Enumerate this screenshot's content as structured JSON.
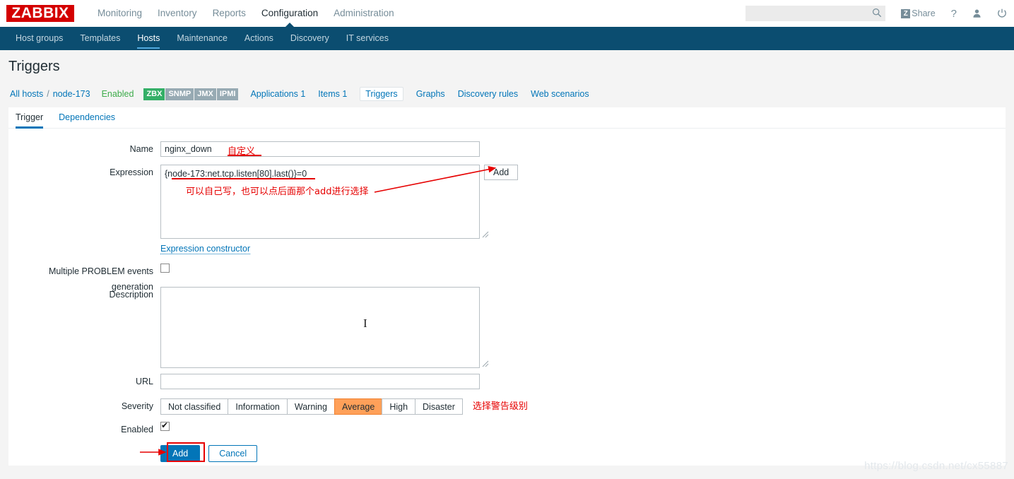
{
  "header": {
    "logo": "ZABBIX",
    "nav": [
      {
        "label": "Monitoring",
        "active": false
      },
      {
        "label": "Inventory",
        "active": false
      },
      {
        "label": "Reports",
        "active": false
      },
      {
        "label": "Configuration",
        "active": true
      },
      {
        "label": "Administration",
        "active": false
      }
    ],
    "search_placeholder": "",
    "search_value": "",
    "search_icon": "search-icon",
    "share_badge": "Z",
    "share_label": "Share",
    "help_icon": "?",
    "user_icon": "user-icon",
    "power_icon": "power-icon"
  },
  "subnav": [
    {
      "label": "Host groups",
      "active": false
    },
    {
      "label": "Templates",
      "active": false
    },
    {
      "label": "Hosts",
      "active": true
    },
    {
      "label": "Maintenance",
      "active": false
    },
    {
      "label": "Actions",
      "active": false
    },
    {
      "label": "Discovery",
      "active": false
    },
    {
      "label": "IT services",
      "active": false
    }
  ],
  "page": {
    "title": "Triggers"
  },
  "breadcrumb": {
    "all_hosts": "All hosts",
    "separator": "/",
    "host": "node-173",
    "status": "Enabled",
    "badges": [
      {
        "label": "ZBX",
        "on": true
      },
      {
        "label": "SNMP",
        "on": false
      },
      {
        "label": "JMX",
        "on": false
      },
      {
        "label": "IPMI",
        "on": false
      }
    ],
    "tabs": [
      {
        "label": "Applications 1",
        "selected": false
      },
      {
        "label": "Items 1",
        "selected": false
      },
      {
        "label": "Triggers",
        "selected": true
      },
      {
        "label": "Graphs",
        "selected": false
      },
      {
        "label": "Discovery rules",
        "selected": false
      },
      {
        "label": "Web scenarios",
        "selected": false
      }
    ]
  },
  "form_tabs": [
    {
      "label": "Trigger",
      "active": true
    },
    {
      "label": "Dependencies",
      "active": false
    }
  ],
  "form": {
    "name_label": "Name",
    "name_value": "nginx_down",
    "name_annotation": "自定义",
    "expression_label": "Expression",
    "expression_value": "{node-173:net.tcp.listen[80].last()}=0",
    "expression_annotation": "可以自己写，也可以点后面那个add进行选择",
    "expression_add_label": "Add",
    "expression_constructor_link": "Expression constructor",
    "multiple_problem_label": "Multiple PROBLEM events generation",
    "multiple_problem_checked": false,
    "description_label": "Description",
    "description_value": "",
    "url_label": "URL",
    "url_value": "",
    "severity_label": "Severity",
    "severity_options": [
      "Not classified",
      "Information",
      "Warning",
      "Average",
      "High",
      "Disaster"
    ],
    "severity_selected": "Average",
    "severity_annotation": "选择警告级别",
    "enabled_label": "Enabled",
    "enabled_checked": true,
    "submit_label": "Add",
    "cancel_label": "Cancel"
  },
  "watermark": "https://blog.csdn.net/cx55887",
  "colors": {
    "brand_red": "#d40000",
    "nav_dark": "#0b4d70",
    "link_blue": "#0275b8",
    "annotation_red": "#e60000",
    "severity_average": "#ffa059",
    "badge_green": "#34af67"
  }
}
